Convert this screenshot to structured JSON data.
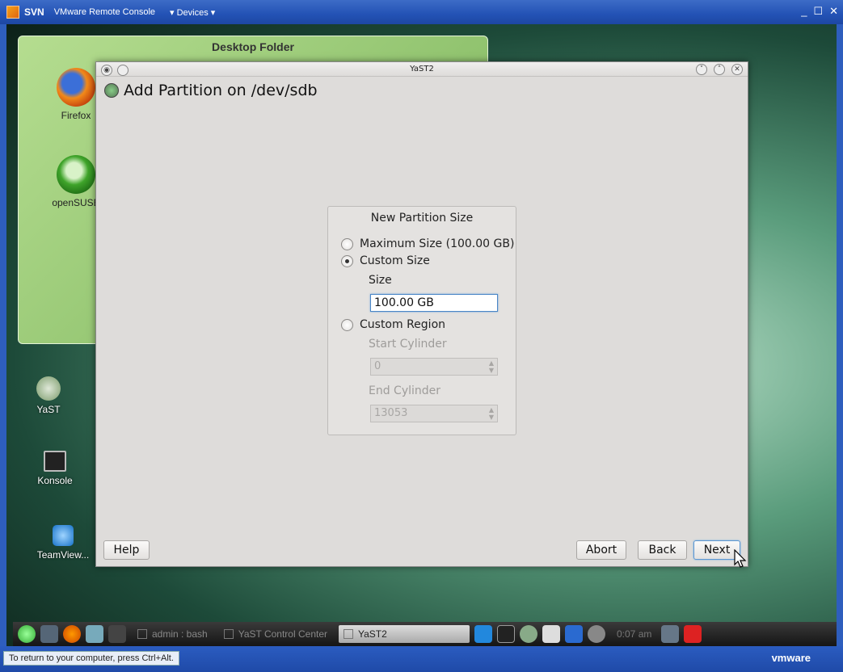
{
  "vm_window": {
    "app_name": "SVN",
    "menu_console": "VMware Remote Console",
    "menu_devices": "Devices",
    "controls": [
      "_",
      "☐",
      "✕"
    ]
  },
  "desktop": {
    "folder_title": "Desktop Folder",
    "icons": [
      {
        "label": "Firefox",
        "icon": "firefox-icon"
      },
      {
        "label": "openSUSE",
        "icon": "opensuse-icon"
      },
      {
        "label": "YaST",
        "icon": "yast-icon"
      },
      {
        "label": "Konsole",
        "icon": "terminal-icon"
      },
      {
        "label": "TeamView...",
        "icon": "teamviewer-icon"
      }
    ]
  },
  "yast": {
    "window_title": "YaST2",
    "heading": "Add Partition on /dev/sdb",
    "group_title": "New Partition Size",
    "options": {
      "maximum": "Maximum Size (100.00 GB)",
      "custom": "Custom Size",
      "region": "Custom Region"
    },
    "size_label": "Size",
    "size_value": "100.00 GB",
    "start_cylinder_label": "Start Cylinder",
    "start_cylinder_value": "0",
    "end_cylinder_label": "End Cylinder",
    "end_cylinder_value": "13053",
    "buttons": {
      "help": "Help",
      "abort": "Abort",
      "back": "Back",
      "next": "Next"
    }
  },
  "taskbar": {
    "tasks": [
      "admin : bash",
      "YaST Control Center",
      "YaST2"
    ],
    "clock": "0:07 am"
  },
  "statusbar": {
    "message": "To return to your computer, press Ctrl+Alt.",
    "brand": "vmware"
  },
  "colors": {
    "vm_blue": "#2352b5",
    "dialog_bg": "#dedcda",
    "focus_blue": "#4a86c6"
  }
}
